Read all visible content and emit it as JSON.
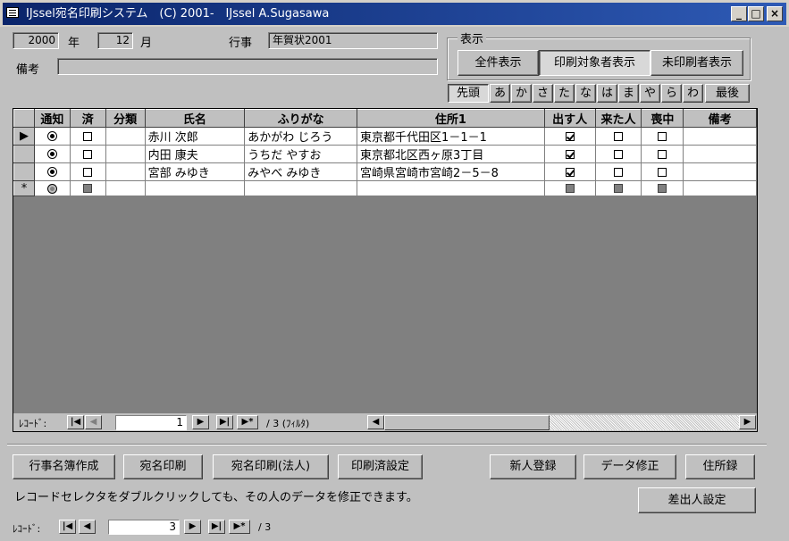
{
  "window": {
    "title": "IJssel宛名印刷システム　(C) 2001-　IJssel A.Sugasawa",
    "controls": [
      "_",
      "□",
      "×"
    ]
  },
  "header": {
    "year_value": "2000",
    "year_label": "年",
    "month_value": "12",
    "month_label": "月",
    "event_label": "行事",
    "event_value": "年賀状2001",
    "note_label": "備考",
    "note_value": ""
  },
  "display": {
    "group_label": "表示",
    "buttons": [
      {
        "label": "全件表示",
        "pressed": false
      },
      {
        "label": "印刷対象者表示",
        "pressed": true
      },
      {
        "label": "未印刷者表示",
        "pressed": false
      }
    ]
  },
  "kana_filter": [
    "先頭",
    "あ",
    "か",
    "さ",
    "た",
    "な",
    "は",
    "ま",
    "や",
    "ら",
    "わ",
    "最後"
  ],
  "grid": {
    "columns": [
      "通知",
      "済",
      "分類",
      "氏名",
      "ふりがな",
      "住所1",
      "出す人",
      "来た人",
      "喪中",
      "備考"
    ],
    "rows": [
      {
        "selector": "▶",
        "notice": "on",
        "done": false,
        "category": "",
        "name": "赤川 次郎",
        "kana": "あかがわ じろう",
        "address": "東京都千代田区1－1－1",
        "send": true,
        "received": false,
        "mourning": false,
        "note": ""
      },
      {
        "selector": "",
        "notice": "on",
        "done": false,
        "category": "",
        "name": "内田 康夫",
        "kana": "うちだ やすお",
        "address": "東京都北区西ヶ原3丁目",
        "send": true,
        "received": false,
        "mourning": false,
        "note": ""
      },
      {
        "selector": "",
        "notice": "on",
        "done": false,
        "category": "",
        "name": "宮部 みゆき",
        "kana": "みやべ みゆき",
        "address": "宮崎県宮崎市宮崎2－5－8",
        "send": true,
        "received": false,
        "mourning": false,
        "note": ""
      }
    ],
    "new_row_selector": "*",
    "nav": {
      "label": "ﾚｺｰﾄﾞ:",
      "current": "1",
      "total": "/ 3 (ﾌｨﾙﾀ)"
    }
  },
  "actions": {
    "event_book": "行事名簿作成",
    "print_address": "宛名印刷",
    "print_address_corp": "宛名印刷(法人)",
    "print_done_setting": "印刷済設定",
    "new_entry": "新人登録",
    "edit_data": "データ修正",
    "address_book": "住所録",
    "sender_setting": "差出人設定"
  },
  "hint": "レコードセレクタをダブルクリックしても、その人のデータを修正できます。",
  "form_nav": {
    "label": "ﾚｺｰﾄﾞ:",
    "current": "3",
    "total": "/ 3"
  }
}
